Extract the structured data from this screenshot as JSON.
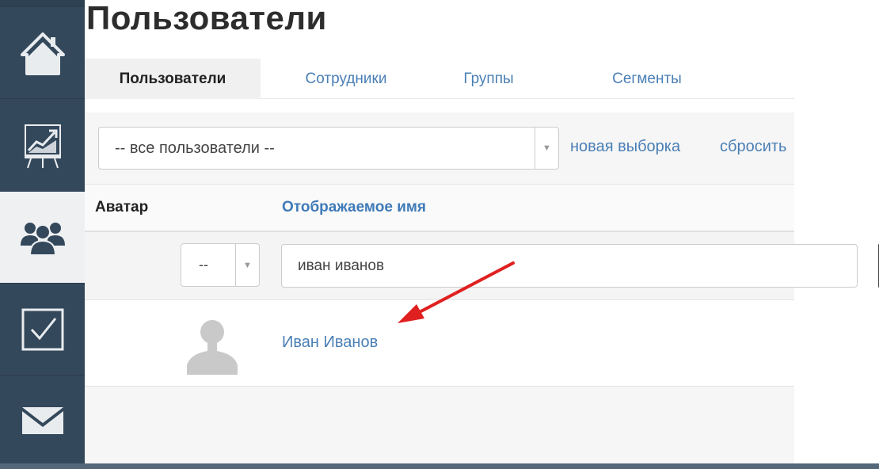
{
  "sidebar": {
    "items": [
      {
        "icon": "home-icon",
        "active": false
      },
      {
        "icon": "chart-board-icon",
        "active": false
      },
      {
        "icon": "users-icon",
        "active": true
      },
      {
        "icon": "checkbox-icon",
        "active": false
      },
      {
        "icon": "envelope-icon",
        "active": false
      }
    ]
  },
  "page": {
    "title": "Пользователи"
  },
  "tabs": [
    {
      "label": "Пользователи",
      "active": true
    },
    {
      "label": "Сотрудники",
      "active": false
    },
    {
      "label": "Группы",
      "active": false
    },
    {
      "label": "Сегменты",
      "active": false
    }
  ],
  "filter_bar": {
    "selection_value": "-- все пользователи --",
    "new_selection_label": "новая выборка",
    "reset_label": "сбросить"
  },
  "table": {
    "headers": {
      "avatar": "Аватар",
      "display_name": "Отображаемое имя"
    },
    "filters": {
      "avatar_value": "--",
      "name_value": "иван иванов"
    },
    "rows": [
      {
        "name": "Иван Иванов",
        "avatar": "placeholder-person"
      }
    ]
  },
  "colors": {
    "sidebar": "#34485b",
    "link": "#4a7fb5",
    "annotation_arrow": "#e02020"
  }
}
